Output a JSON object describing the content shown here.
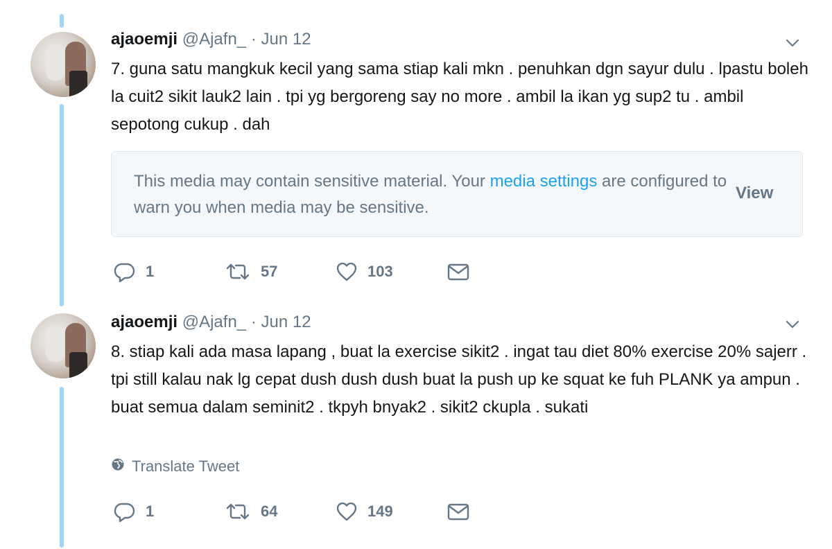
{
  "tweets": [
    {
      "author_name": "ajaoemji",
      "author_handle": "@Ajafn_",
      "separator": "·",
      "date": "Jun 12",
      "text": "7. guna satu mangkuk kecil yang sama stiap kali mkn . penuhkan dgn sayur dulu . lpastu boleh la cuit2 sikit lauk2 lain . tpi yg bergoreng say no more . ambil la ikan yg sup2 tu . ambil sepotong cukup . dah",
      "sensitive_notice": {
        "text_before": "This media may contain sensitive material. Your ",
        "link_text": "media settings",
        "text_after": " are configured to warn you when media may be sensitive.",
        "view_label": "View"
      },
      "replies": "1",
      "retweets": "57",
      "likes": "103"
    },
    {
      "author_name": "ajaoemji",
      "author_handle": "@Ajafn_",
      "separator": "·",
      "date": "Jun 12",
      "text": "8. stiap kali ada masa lapang , buat la exercise sikit2 . ingat tau diet 80% exercise 20% sajerr . tpi still kalau nak lg cepat dush dush dush buat la push up ke squat ke fuh PLANK ya ampun . buat semua dalam seminit2 . tkpyh bnyak2 . sikit2 ckupla . sukati",
      "translate_label": "Translate Tweet",
      "replies": "1",
      "retweets": "64",
      "likes": "149"
    }
  ],
  "icons": {
    "reply": "reply-icon",
    "retweet": "retweet-icon",
    "like": "heart-icon",
    "dm": "envelope-icon",
    "more": "chevron-down-icon",
    "translate": "globe-icon"
  },
  "colors": {
    "thread_line": "#a3d4f5",
    "link": "#1da1f2",
    "muted": "#657786",
    "text": "#14171a"
  }
}
